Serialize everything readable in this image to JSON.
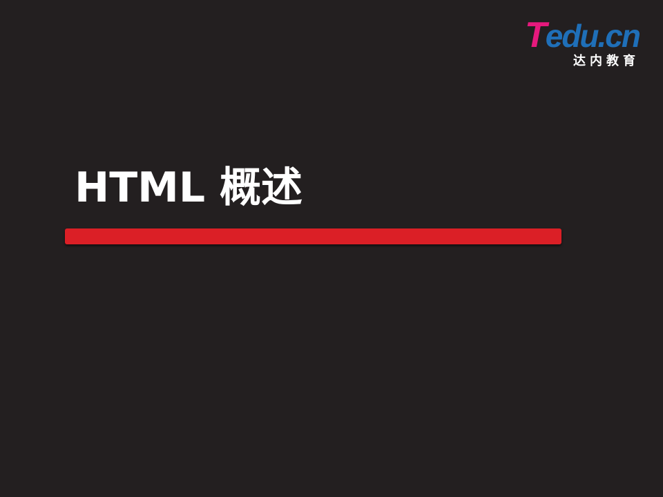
{
  "logo": {
    "brand_letter": "T",
    "brand_rest": "edu.cn",
    "subtitle": "达内教育",
    "colors": {
      "t": "#e6197d",
      "rest": "#1f6fb8"
    }
  },
  "slide": {
    "title": "HTML 概述",
    "background": "#231f20",
    "accent_color": "#db1f26"
  }
}
